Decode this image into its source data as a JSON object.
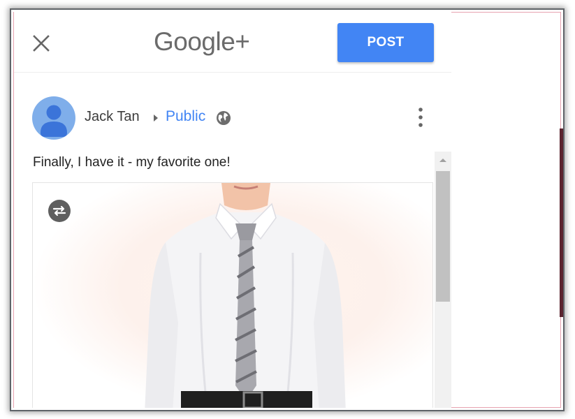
{
  "header": {
    "close_icon": "close-icon",
    "logo_text": "Google+",
    "post_label": "POST"
  },
  "author": {
    "name": "Jack Tan",
    "audience": "Public",
    "avatar_icon": "person-avatar-icon",
    "audience_icon": "globe-icon",
    "more_icon": "more-vertical-icon"
  },
  "post": {
    "text": "Finally, I have it - my favorite one!",
    "image_icon": "photo-shirt-and-tie",
    "swap_icon": "swap-arrows-icon"
  },
  "colors": {
    "accent": "#4285f4",
    "logo_gray": "#6b6b6b",
    "avatar_blue": "#7faeea"
  }
}
